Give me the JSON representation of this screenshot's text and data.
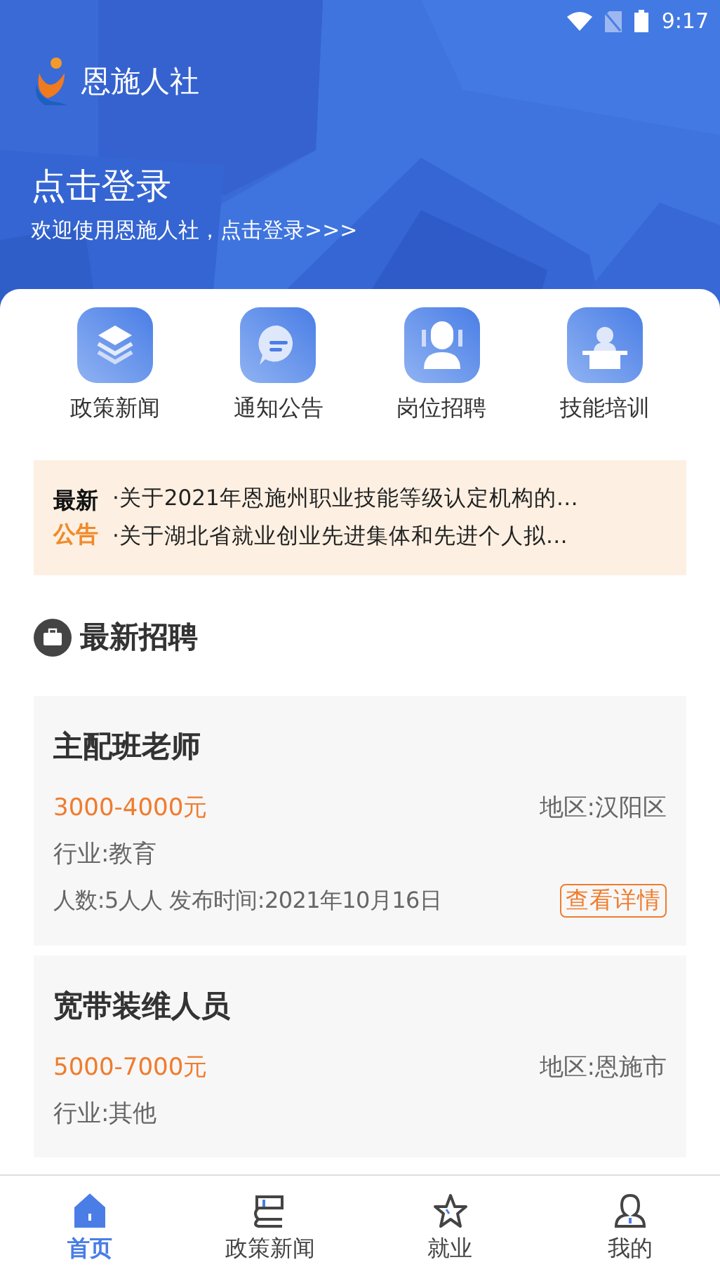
{
  "status_bar": {
    "time": "9:17"
  },
  "header": {
    "app_name": "恩施人社",
    "login_title": "点击登录",
    "login_subtitle": "欢迎使用恩施人社，点击登录>>>"
  },
  "shortcuts": [
    {
      "kind": "layers",
      "label": "政策新闻"
    },
    {
      "kind": "chat",
      "label": "通知公告"
    },
    {
      "kind": "people",
      "label": "岗位招聘"
    },
    {
      "kind": "lecture",
      "label": "技能培训"
    }
  ],
  "notices": {
    "badge_top": "最新",
    "badge_bottom": "公告",
    "items": [
      "·关于2021年恩施州职业技能等级认定机构的…",
      "·关于湖北省就业创业先进集体和先进个人拟…"
    ]
  },
  "section_title": "最新招聘",
  "jobs": [
    {
      "title": "主配班老师",
      "salary": "3000-4000元",
      "region": "地区:汉阳区",
      "industry": "行业:教育",
      "details": "人数:5人人 发布时间:2021年10月16日",
      "action": "查看详情"
    },
    {
      "title": "宽带装维人员",
      "salary": "5000-7000元",
      "region": "地区:恩施市",
      "industry": "行业:其他"
    }
  ],
  "tab_bar": [
    {
      "kind": "home",
      "label": "首页",
      "selected": true
    },
    {
      "kind": "books",
      "label": "政策新闻",
      "selected": false
    },
    {
      "kind": "star",
      "label": "就业",
      "selected": false
    },
    {
      "kind": "person",
      "label": "我的",
      "selected": false
    }
  ]
}
